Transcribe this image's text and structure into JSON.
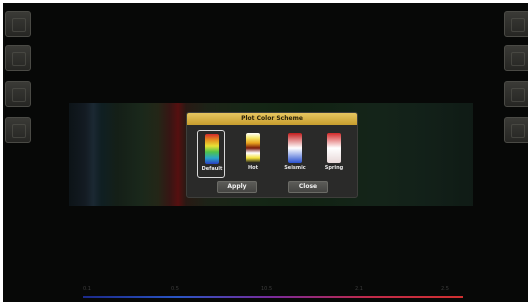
{
  "dialog": {
    "title": "Plot Color Scheme",
    "schemes": [
      {
        "label": "Default",
        "selected": true,
        "colors": [
          "#d42a2a",
          "#e58f1f",
          "#e8e135",
          "#4fc24a",
          "#2aa6c9",
          "#2a3fc2"
        ]
      },
      {
        "label": "Hot",
        "selected": false,
        "colors": [
          "#ffffff",
          "#f5e76a",
          "#e8a31e",
          "#7a1a0a",
          "#ffffff",
          "#f4e23a",
          "#1a1a1a"
        ]
      },
      {
        "label": "Seismic",
        "selected": false,
        "colors": [
          "#c41e1e",
          "#ffffff",
          "#2a52d0"
        ]
      },
      {
        "label": "Spring",
        "selected": false,
        "colors": [
          "#d42a2a",
          "#ffffff",
          "#e8d8d8"
        ]
      }
    ],
    "apply_label": "Apply",
    "close_label": "Close"
  },
  "axis": {
    "ticks": [
      "0.1",
      "0.5",
      "10.5",
      "2.1",
      "2.5"
    ]
  }
}
